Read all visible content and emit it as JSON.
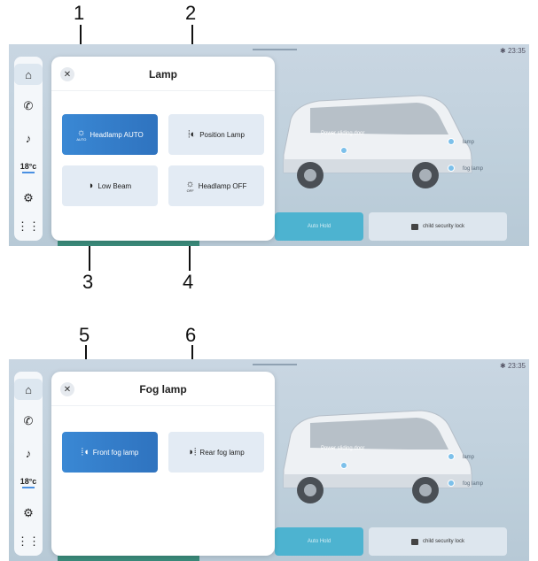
{
  "callouts": [
    "1",
    "2",
    "3",
    "4",
    "5",
    "6"
  ],
  "screen1": {
    "status": "✱  23:35",
    "sidebar": {
      "temp": "18°c"
    },
    "panel": {
      "title": "Lamp",
      "buttons": {
        "headlamp_auto": {
          "label": "Headlamp AUTO",
          "sub": "AUTO"
        },
        "position_lamp": {
          "label": "Position Lamp"
        },
        "low_beam": {
          "label": "Low Beam"
        },
        "headlamp_off": {
          "label": "Headlamp OFF",
          "sub": "OFF"
        }
      }
    },
    "vehicle": {
      "door_label": "Power sliding door",
      "lamp_label": "lamp",
      "fog_label": "fog lamp"
    },
    "tiles": {
      "auto_hold": "Auto Hold",
      "child_lock": "child security lock"
    }
  },
  "screen2": {
    "status": "✱  23:35",
    "sidebar": {
      "temp": "18°c"
    },
    "panel": {
      "title": "Fog lamp",
      "buttons": {
        "front_fog": {
          "label": "Front fog lamp"
        },
        "rear_fog": {
          "label": "Rear fog lamp"
        }
      }
    },
    "vehicle": {
      "door_label": "Power sliding door",
      "lamp_label": "lamp",
      "fog_label": "fog lamp"
    },
    "tiles": {
      "auto_hold": "Auto Hold",
      "child_lock": "child security lock"
    }
  },
  "colors": {
    "accent": "#3a88d4",
    "button": "#e3ebf4",
    "panel": "#ffffff"
  },
  "icons": [
    "home-icon",
    "phone-icon",
    "music-icon",
    "settings-icon",
    "apps-icon",
    "close-icon",
    "lamp-auto-icon",
    "position-lamp-icon",
    "low-beam-icon",
    "lamp-off-icon",
    "front-fog-icon",
    "rear-fog-icon",
    "lock-icon"
  ]
}
